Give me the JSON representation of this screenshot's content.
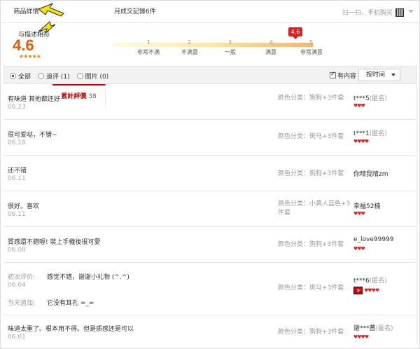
{
  "tabs": {
    "details": "商品詳情",
    "reviews_label": "累計評價",
    "reviews_count": "38",
    "monthly": "月成交記錄6件"
  },
  "scan_buy": "扫一扫，手机购买",
  "summary": {
    "label": "与描述相符",
    "score": "4.6",
    "stars": "★★★★★",
    "marker": "4.6",
    "ticks": [
      "1",
      "2",
      "3",
      "4",
      "5"
    ],
    "tick_labels": [
      "非常不满",
      "不满意",
      "一般",
      "满意",
      "非常满意"
    ],
    "score_value": 4.6
  },
  "filter": {
    "all": "全部",
    "followup": "追评 (1)",
    "images": "图片 (0)",
    "has_content": "有内容",
    "sort": "按时间"
  },
  "reviews": [
    {
      "text": "有味道 其他都还好",
      "date": "06.23",
      "sku": "颜色分类：狗狗+3件套",
      "user": "t***5",
      "anon": "(匿名)",
      "hearts": "♥♥♥"
    },
    {
      "text": "很可爱哒，不错~",
      "date": "06.18",
      "sku": "颜色分类：斑马+3件套",
      "user": "t***1",
      "anon": "(匿名)",
      "hearts": "♥♥♥♥"
    },
    {
      "text": "还不错",
      "date": "06.11",
      "sku": "颜色分类：狗狗+3件套",
      "user": "你晴我晴zm",
      "anon": "",
      "hearts": ""
    },
    {
      "text": "很好。喜欢",
      "date": "06.11",
      "sku": "颜色分类：小黄人蓝色+3件套",
      "user": "幸福52楠",
      "anon": "",
      "hearts": "♥♥♥"
    },
    {
      "text": "質感還不錯喔! 裝上手機後很可愛",
      "date": "06.08",
      "sku": "颜色分类：狗狗+3件套",
      "user": "e_love99999",
      "anon": "",
      "hearts": "♥♥♥"
    },
    {
      "initial_label": "初次评价:",
      "text": "感觉不错，谢谢小礼物 (^.^)",
      "date": "06.04",
      "followup_label": "当天追加:",
      "followup": "它没有耳孔 =_=",
      "sku": "颜色分类：斑马+3件套",
      "user": "t***6",
      "anon": "(匿名)",
      "badge": "TF",
      "hearts": "♥♥♥♥"
    },
    {
      "text": "味道太重了。根本用不得。但是质感还是可以",
      "date": "06.01",
      "sku": "颜色分类：狗狗+3件套",
      "user": "谢***茜",
      "anon": "(匿名)",
      "hearts": "♥♥♥♥"
    }
  ]
}
